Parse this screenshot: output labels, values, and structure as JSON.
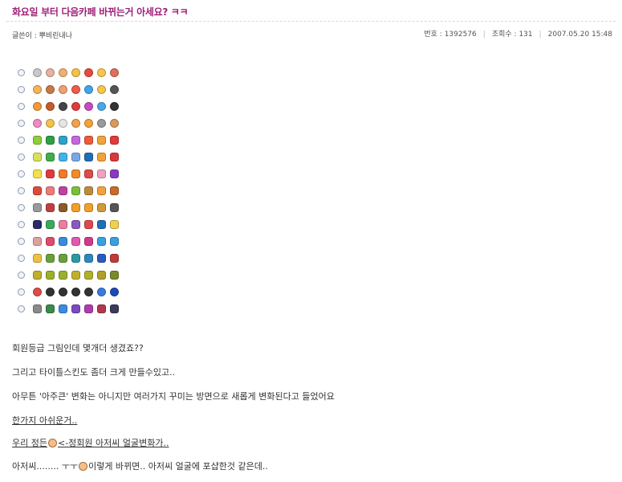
{
  "post": {
    "title": "화요일 부터 다음카페 바뀌는거 아세요? ㅋㅋ",
    "author_label": "글쓴이 : 뿌비린내나",
    "number_label": "번호 : 1392576",
    "views_label": "조회수 : 131",
    "date": "2007.05.20 15:48"
  },
  "emoticon_rows": [
    {
      "icons": [
        "#c9c9c9",
        "#e8b2a0",
        "#f0b070",
        "#f4c24a",
        "#e54b3c",
        "#f7c64a",
        "#e0705a"
      ]
    },
    {
      "icons": [
        "#f4b45a",
        "#c87a44",
        "#f0a070",
        "#f25a4a",
        "#3fa6e8",
        "#f7c64a",
        "#555555"
      ]
    },
    {
      "icons": [
        "#f39a3a",
        "#c45c2a",
        "#444444",
        "#e23a3a",
        "#c94ac2",
        "#4aa8e8",
        "#333333"
      ]
    },
    {
      "icons": [
        "#ef8bc2",
        "#f4c24a",
        "#e5e5e5",
        "#f3a04a",
        "#f2a23a",
        "#9a9a9a",
        "#d99a5a"
      ]
    },
    {
      "icons": [
        "#8ccf3a",
        "#2ea043",
        "#2aa3c8",
        "#c566e0",
        "#f05a3a",
        "#f2a23a",
        "#e23a3a"
      ]
    },
    {
      "icons": [
        "#d6e05a",
        "#3fae49",
        "#3fb4e8",
        "#7aa6e8",
        "#1e6fb8",
        "#f2a23a",
        "#d83a3a"
      ]
    },
    {
      "icons": [
        "#f2e24a",
        "#e23a3a",
        "#f27a2a",
        "#f28a2a",
        "#e04a4a",
        "#f0a0c0",
        "#8a3ac2"
      ]
    },
    {
      "icons": [
        "#e04a3a",
        "#f07a7a",
        "#c040a0",
        "#7ac03a",
        "#c08a3a",
        "#f2a23a",
        "#c86a2a"
      ]
    },
    {
      "icons": [
        "#9a9a9a",
        "#c04040",
        "#8a5a2a",
        "#f0a02a",
        "#f0a02a",
        "#d09a3a",
        "#555555"
      ]
    },
    {
      "icons": [
        "#2a2a6a",
        "#3aaa5a",
        "#f07aa0",
        "#8a5ac2",
        "#e04a4a",
        "#1e6fb8",
        "#f0d050"
      ]
    },
    {
      "icons": [
        "#e0a0a0",
        "#e04a6a",
        "#3a8ae0",
        "#e05ab0",
        "#d03a8a",
        "#3aa0e0",
        "#3aa0e0"
      ]
    },
    {
      "icons": [
        "#f0c040",
        "#6aa03a",
        "#6aa03a",
        "#2a9aa0",
        "#2a8ac0",
        "#2a5ac0",
        "#c03a3a"
      ]
    },
    {
      "icons": [
        "#c0b02a",
        "#9ab02a",
        "#9ab02a",
        "#c0b02a",
        "#b0b02a",
        "#b0a02a",
        "#7a8a2a"
      ]
    },
    {
      "icons": [
        "#e04a4a",
        "#333333",
        "#333333",
        "#333333",
        "#333333",
        "#3a7ae0",
        "#1e4ab8"
      ]
    },
    {
      "icons": [
        "#8a8a8a",
        "#3a8a4a",
        "#3a8ae0",
        "#7a4ac0",
        "#b03ab0",
        "#b03a4a",
        "#3a3a5a"
      ]
    }
  ],
  "body_text": {
    "p1": "회원등급 그림인데 몇개더 생겼죠??",
    "p2": "그리고 타이틀스킨도 좀더 크게 만들수있고..",
    "p3": "아무튼 '아주큰' 변화는 아니지만 여러가지 꾸미는 방면으로 새롭게 변화된다고 들었어요",
    "p4": "한가지 아쉬운거..",
    "p5_a": "우리 정든",
    "p5_b": "<-정회원 아저씨 얼굴변화가..",
    "p6_a": "아저씨........ ㅜㅜ",
    "p6_b": "이렇게 바뀌면.. 아저씨 얼굴에 포샵한것 같은데.."
  }
}
